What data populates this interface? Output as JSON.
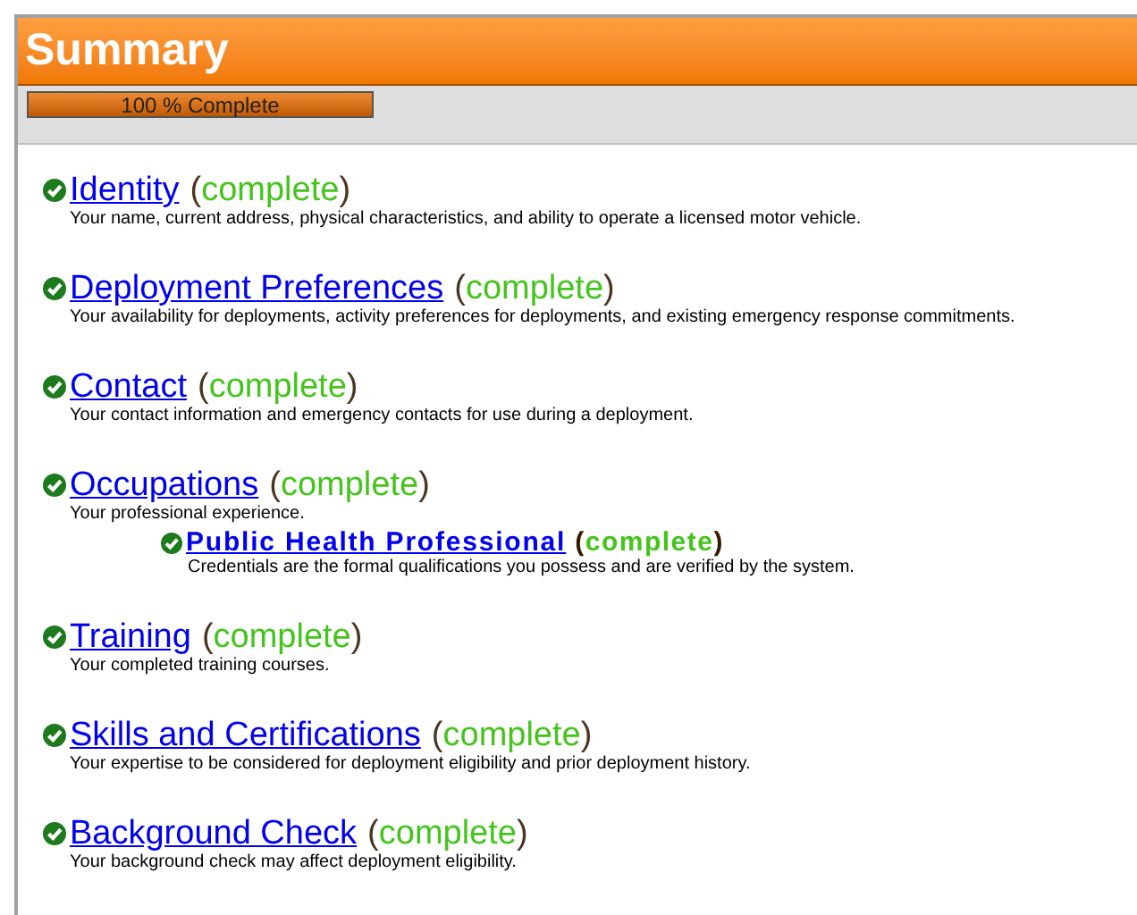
{
  "header": {
    "title": "Summary"
  },
  "progress": {
    "label": "100 % Complete",
    "level": 1
  },
  "sections": [
    {
      "title": "Identity",
      "status": {
        "open": "(",
        "text": "complete",
        "close": ")"
      },
      "completed": true,
      "description": "Your name, current address, physical characteristics, and ability to operate a licensed motor vehicle."
    },
    {
      "title": "Deployment Preferences",
      "status": {
        "open": "(",
        "text": "complete",
        "close": ")"
      },
      "completed": true,
      "description": "Your availability for deployments, activity preferences for deployments, and existing emergency response commitments."
    },
    {
      "title": "Contact",
      "status": {
        "open": "(",
        "text": "complete",
        "close": ")"
      },
      "completed": true,
      "description": "Your contact information and emergency contacts for use during a deployment."
    },
    {
      "title": "Occupations",
      "status": {
        "open": "(",
        "text": "complete",
        "close": ")"
      },
      "completed": true,
      "description": "Your professional experience.",
      "children": [
        {
          "title": "Public Health Professional",
          "status": {
            "open": "(",
            "text": "complete",
            "close": ")"
          },
          "completed": true,
          "description": "Credentials are the formal qualifications you possess and are verified by the system."
        }
      ]
    },
    {
      "title": "Training",
      "status": {
        "open": "(",
        "text": "complete",
        "close": ")"
      },
      "completed": true,
      "description": "Your completed training courses."
    },
    {
      "title": "Skills and Certifications",
      "status": {
        "open": "(",
        "text": "complete",
        "close": ")"
      },
      "completed": true,
      "description": "Your expertise to be considered for deployment eligibility and prior deployment history."
    },
    {
      "title": "Background Check",
      "status": {
        "open": "(",
        "text": "complete",
        "close": ")"
      },
      "completed": true,
      "description": "Your background check may affect deployment eligibility."
    }
  ]
}
